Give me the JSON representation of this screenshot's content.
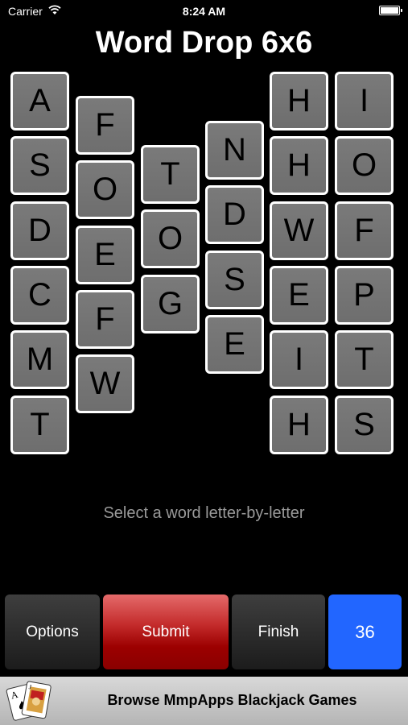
{
  "status": {
    "carrier": "Carrier",
    "time": "8:24 AM"
  },
  "title": "Word Drop 6x6",
  "columns": [
    [
      "A",
      "S",
      "D",
      "C",
      "M",
      "T"
    ],
    [
      "F",
      "O",
      "E",
      "F",
      "W"
    ],
    [
      "T",
      "O",
      "G"
    ],
    [
      "N",
      "D",
      "S",
      "E"
    ],
    [
      "H",
      "H",
      "W",
      "E",
      "I",
      "H"
    ],
    [
      "I",
      "O",
      "F",
      "P",
      "T",
      "S"
    ]
  ],
  "instruction": "Select a word letter-by-letter",
  "buttons": {
    "options": "Options",
    "submit": "Submit",
    "finish": "Finish",
    "count": "36"
  },
  "ad": {
    "text": "Browse MmpApps Blackjack Games",
    "icon": "playing-cards-icon"
  },
  "colors": {
    "background": "#000000",
    "tile": "#707070",
    "tile_border": "#ffffff",
    "submit": "#b30000",
    "count": "#2266ff"
  }
}
